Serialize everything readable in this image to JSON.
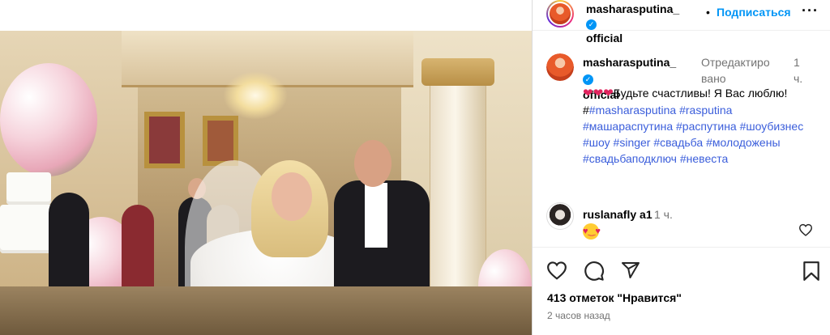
{
  "post": {
    "username_line1": "masharasputina_",
    "username_line2": "official",
    "follow_label": "Подписаться",
    "dot": "•",
    "more": "···"
  },
  "caption": {
    "username_line1": "masharasputina_",
    "username_line2": "official",
    "edited_line1": "Отредактиро",
    "edited_line2": "вано",
    "time_line1": "1",
    "time_line2": "ч.",
    "text": "Будьте счастливы! Я Вас люблю! #",
    "hashtags": [
      "#masharasputina",
      "#rasputina",
      "#машараспутина",
      "#распутина",
      "#шоубизнес",
      "#шоу",
      "#singer",
      "#свадьба",
      "#молодожены",
      "#свадьбаподключ",
      "#невеста"
    ]
  },
  "comment": {
    "username": "ruslanafly a1",
    "time": "1 ч."
  },
  "likes": "413 отметок \"Нравится\"",
  "post_time": "2 часов назад",
  "icons": {
    "like": "heart-icon",
    "comment": "comment-icon",
    "share": "share-icon",
    "save": "bookmark-icon",
    "verified": "verified-badge-icon"
  },
  "colors": {
    "accent": "#0095f6",
    "hashtag": "#3b5edb",
    "muted": "#737373"
  }
}
